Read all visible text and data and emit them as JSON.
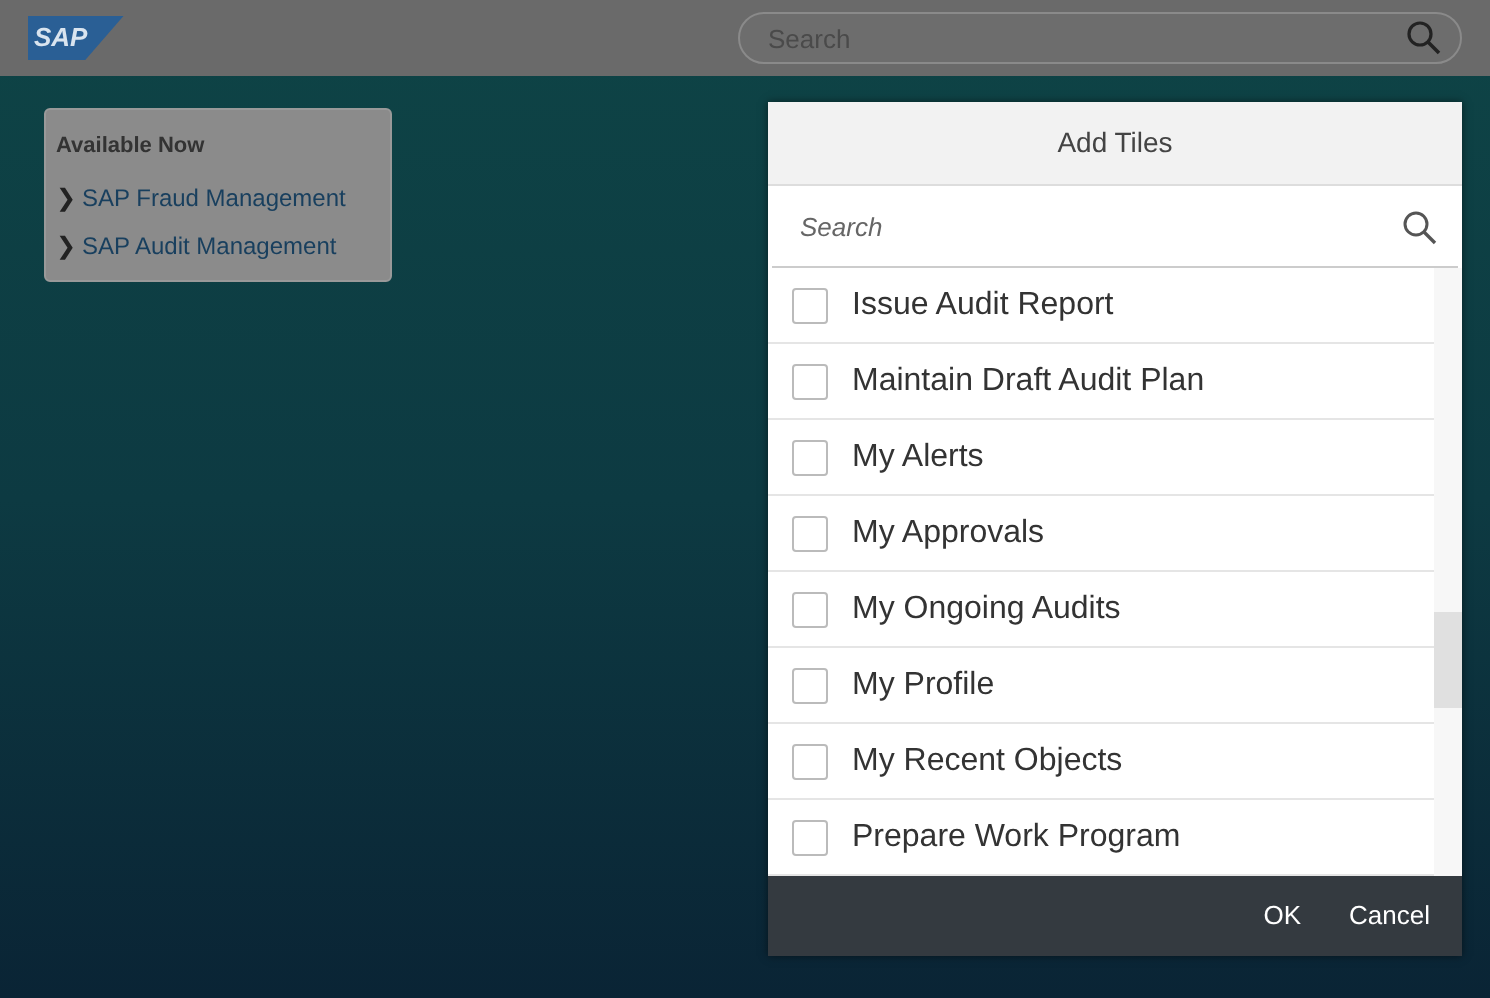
{
  "header": {
    "logo": "SAP",
    "search": {
      "placeholder": "Search"
    }
  },
  "available_panel": {
    "title": "Available Now",
    "items": [
      {
        "marker": "❯",
        "label": "SAP Fraud Management"
      },
      {
        "marker": "❯",
        "label": "SAP Audit Management"
      }
    ]
  },
  "dialog": {
    "title": "Add Tiles",
    "search": {
      "placeholder": "Search"
    },
    "items": [
      {
        "label": "Issue Audit Report",
        "checked": false
      },
      {
        "label": "Maintain Draft Audit Plan",
        "checked": false
      },
      {
        "label": "My Alerts",
        "checked": false
      },
      {
        "label": "My Approvals",
        "checked": false
      },
      {
        "label": "My Ongoing Audits",
        "checked": false
      },
      {
        "label": "My Profile",
        "checked": false
      },
      {
        "label": "My Recent Objects",
        "checked": false
      },
      {
        "label": "Prepare Work Program",
        "checked": false
      }
    ],
    "buttons": [
      "OK",
      "Cancel"
    ]
  }
}
